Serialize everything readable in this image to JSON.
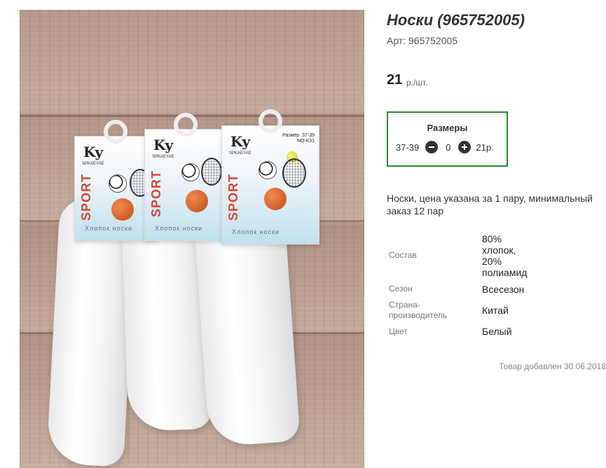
{
  "product": {
    "title": "Носки (965752005)",
    "sku_label": "Арт: 965752005",
    "price": "21",
    "price_unit": "р./шт.",
    "image_alt": "Носки"
  },
  "sizes": {
    "title": "Размеры",
    "items": [
      {
        "label": "37-39",
        "quantity": "0",
        "price": "21р."
      }
    ]
  },
  "description": "Носки, цена указана за 1 пару, минимальный заказ 12 пар",
  "attributes": [
    {
      "label": "Состав",
      "value": "80% хлопок, 20% полиамид"
    },
    {
      "label": "Сезон",
      "value": "Всесезон"
    },
    {
      "label": "Страна-производитель",
      "value": "Китай"
    },
    {
      "label": "Цвет",
      "value": "Белый"
    }
  ],
  "added_note": "Товар добавлен 30.06.2018",
  "packaging": {
    "brand": "Ky",
    "brand_sub": "SPKAEYAE",
    "sport": "SPORT",
    "cotton": "Хлопок носки",
    "size_1": "Размер :37-39",
    "size_2": "NO:K31"
  },
  "colors": {
    "sizes_border": "#2b8a2b",
    "button": "#333333"
  }
}
